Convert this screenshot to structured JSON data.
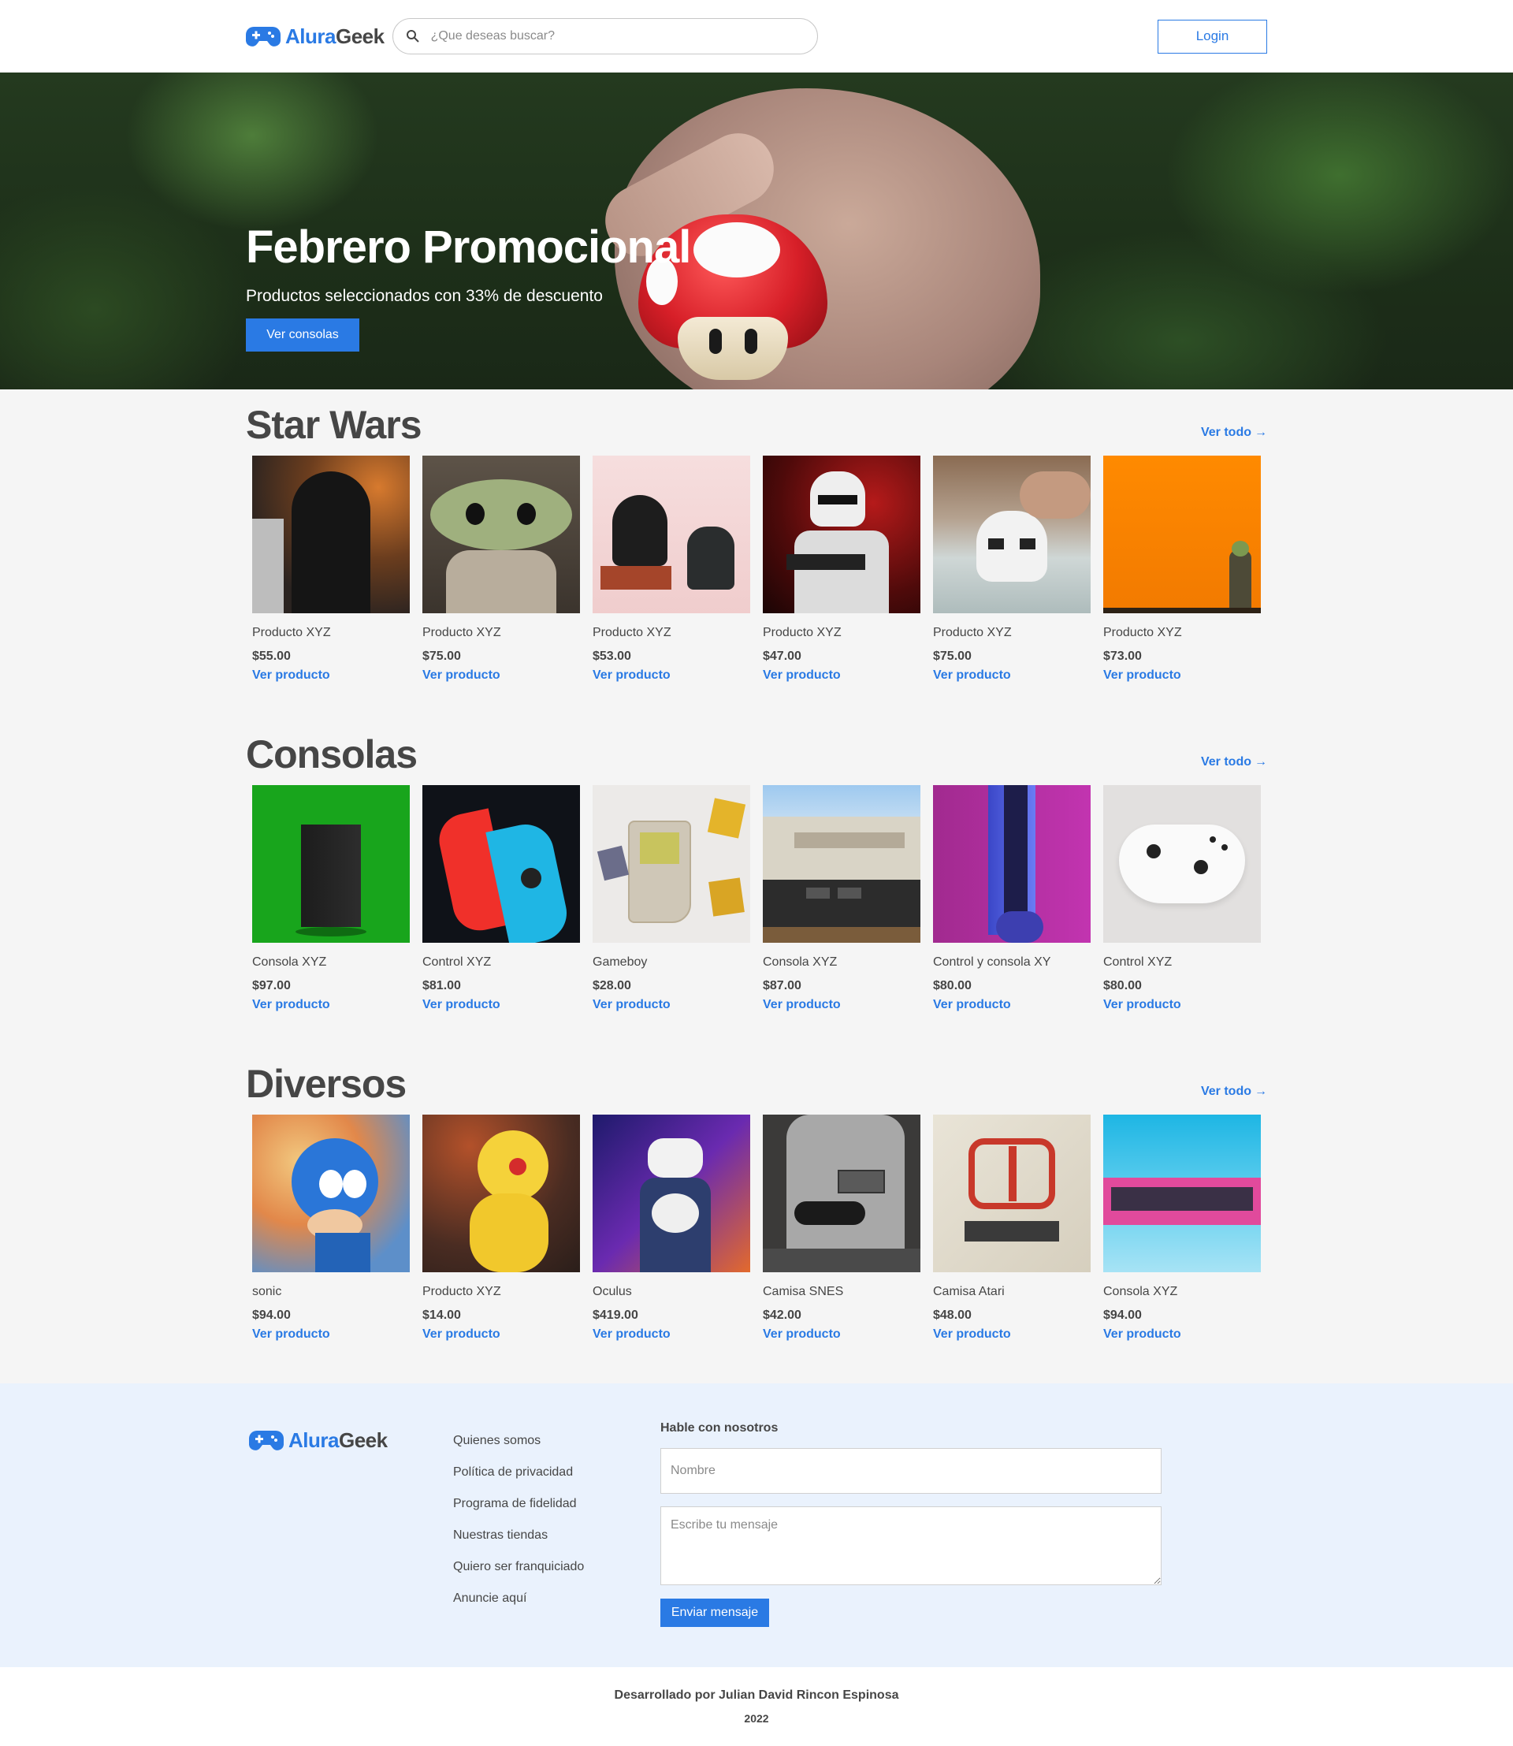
{
  "header": {
    "logo_prefix": "Alura",
    "logo_suffix": "Geek",
    "search_placeholder": "¿Que deseas buscar?",
    "login_label": "Login"
  },
  "hero": {
    "title": "Febrero Promocional",
    "subtitle": "Productos seleccionados con 33% de descuento",
    "button_label": "Ver consolas"
  },
  "sections": [
    {
      "title": "Star Wars",
      "see_all": "Ver todo",
      "products": [
        {
          "name": "Producto XYZ",
          "price": "$55.00",
          "link": "Ver producto"
        },
        {
          "name": "Producto XYZ",
          "price": "$75.00",
          "link": "Ver producto"
        },
        {
          "name": "Producto XYZ",
          "price": "$53.00",
          "link": "Ver producto"
        },
        {
          "name": "Producto XYZ",
          "price": "$47.00",
          "link": "Ver producto"
        },
        {
          "name": "Producto XYZ",
          "price": "$75.00",
          "link": "Ver producto"
        },
        {
          "name": "Producto XYZ",
          "price": "$73.00",
          "link": "Ver producto"
        }
      ]
    },
    {
      "title": "Consolas",
      "see_all": "Ver todo",
      "products": [
        {
          "name": "Consola XYZ",
          "price": "$97.00",
          "link": "Ver producto"
        },
        {
          "name": "Control XYZ",
          "price": "$81.00",
          "link": "Ver producto"
        },
        {
          "name": "Gameboy",
          "price": "$28.00",
          "link": "Ver producto"
        },
        {
          "name": "Consola XYZ",
          "price": "$87.00",
          "link": "Ver producto"
        },
        {
          "name": "Control y consola XY",
          "price": "$80.00",
          "link": "Ver producto"
        },
        {
          "name": "Control XYZ",
          "price": "$80.00",
          "link": "Ver producto"
        }
      ]
    },
    {
      "title": "Diversos",
      "see_all": "Ver todo",
      "products": [
        {
          "name": "sonic",
          "price": "$94.00",
          "link": "Ver producto"
        },
        {
          "name": "Producto XYZ",
          "price": "$14.00",
          "link": "Ver producto"
        },
        {
          "name": "Oculus",
          "price": "$419.00",
          "link": "Ver producto"
        },
        {
          "name": "Camisa SNES",
          "price": "$42.00",
          "link": "Ver producto"
        },
        {
          "name": "Camisa Atari",
          "price": "$48.00",
          "link": "Ver producto"
        },
        {
          "name": "Consola XYZ",
          "price": "$94.00",
          "link": "Ver producto"
        }
      ]
    }
  ],
  "footer": {
    "logo_prefix": "Alura",
    "logo_suffix": "Geek",
    "links": [
      "Quienes somos",
      "Política de privacidad",
      "Programa de fidelidad",
      "Nuestras tiendas",
      "Quiero ser franquiciado",
      "Anuncie aquí"
    ],
    "form_title": "Hable con nosotros",
    "name_placeholder": "Nombre",
    "message_placeholder": "Escribe tu mensaje",
    "submit_label": "Enviar mensaje"
  },
  "credits": {
    "developer": "Desarrollado por Julian David Rincon Espinosa",
    "year": "2022"
  },
  "colors": {
    "accent": "#2a7ae4",
    "text": "#464646",
    "footer_bg": "#eaf2fd",
    "page_bg": "#f5f5f5"
  },
  "icons": {
    "logo": "gamepad-icon",
    "search": "search-icon",
    "see_all": "arrow-right-icon"
  }
}
